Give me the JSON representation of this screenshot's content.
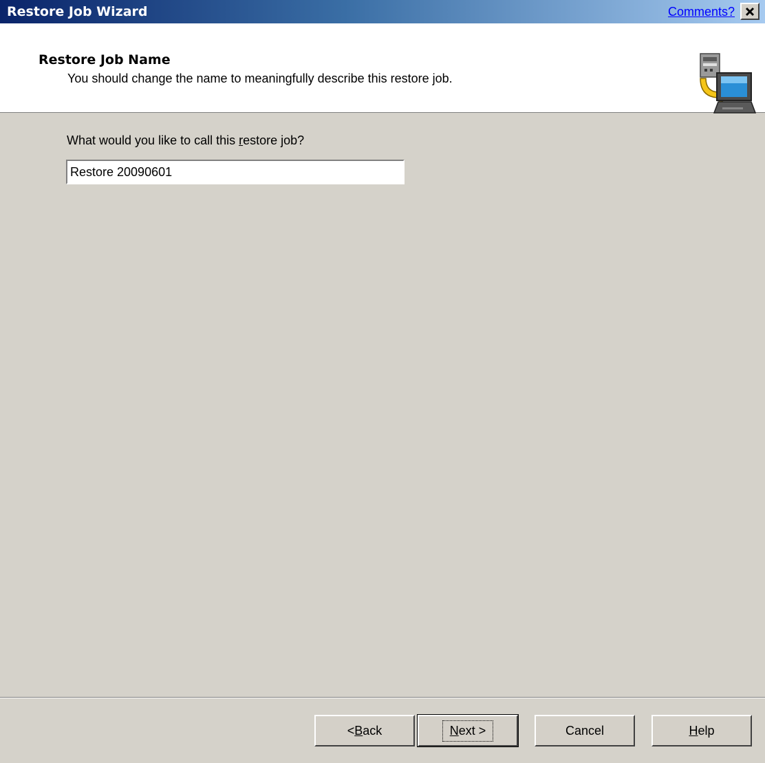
{
  "window": {
    "title": "Restore Job Wizard",
    "comments_link": "Comments?",
    "close_icon": "close-icon"
  },
  "header": {
    "title": "Restore Job Name",
    "subtitle": "You should change the name to meaningfully describe this restore job.",
    "icon": "restore-computer-icon"
  },
  "form": {
    "question_before": "What would you like to call this ",
    "question_underlined": "r",
    "question_after": "estore job?",
    "name_value": "Restore 20090601"
  },
  "buttons": {
    "back_prefix": "< ",
    "back_underlined": "B",
    "back_rest": "ack",
    "next_underlined": "N",
    "next_rest": "ext >",
    "cancel": "Cancel",
    "help_underlined": "H",
    "help_rest": "elp"
  },
  "colors": {
    "title_bar_start": "#0a246a",
    "title_bar_end": "#a6caf0",
    "dialog_background": "#d5d2ca",
    "link": "#0000ff"
  }
}
